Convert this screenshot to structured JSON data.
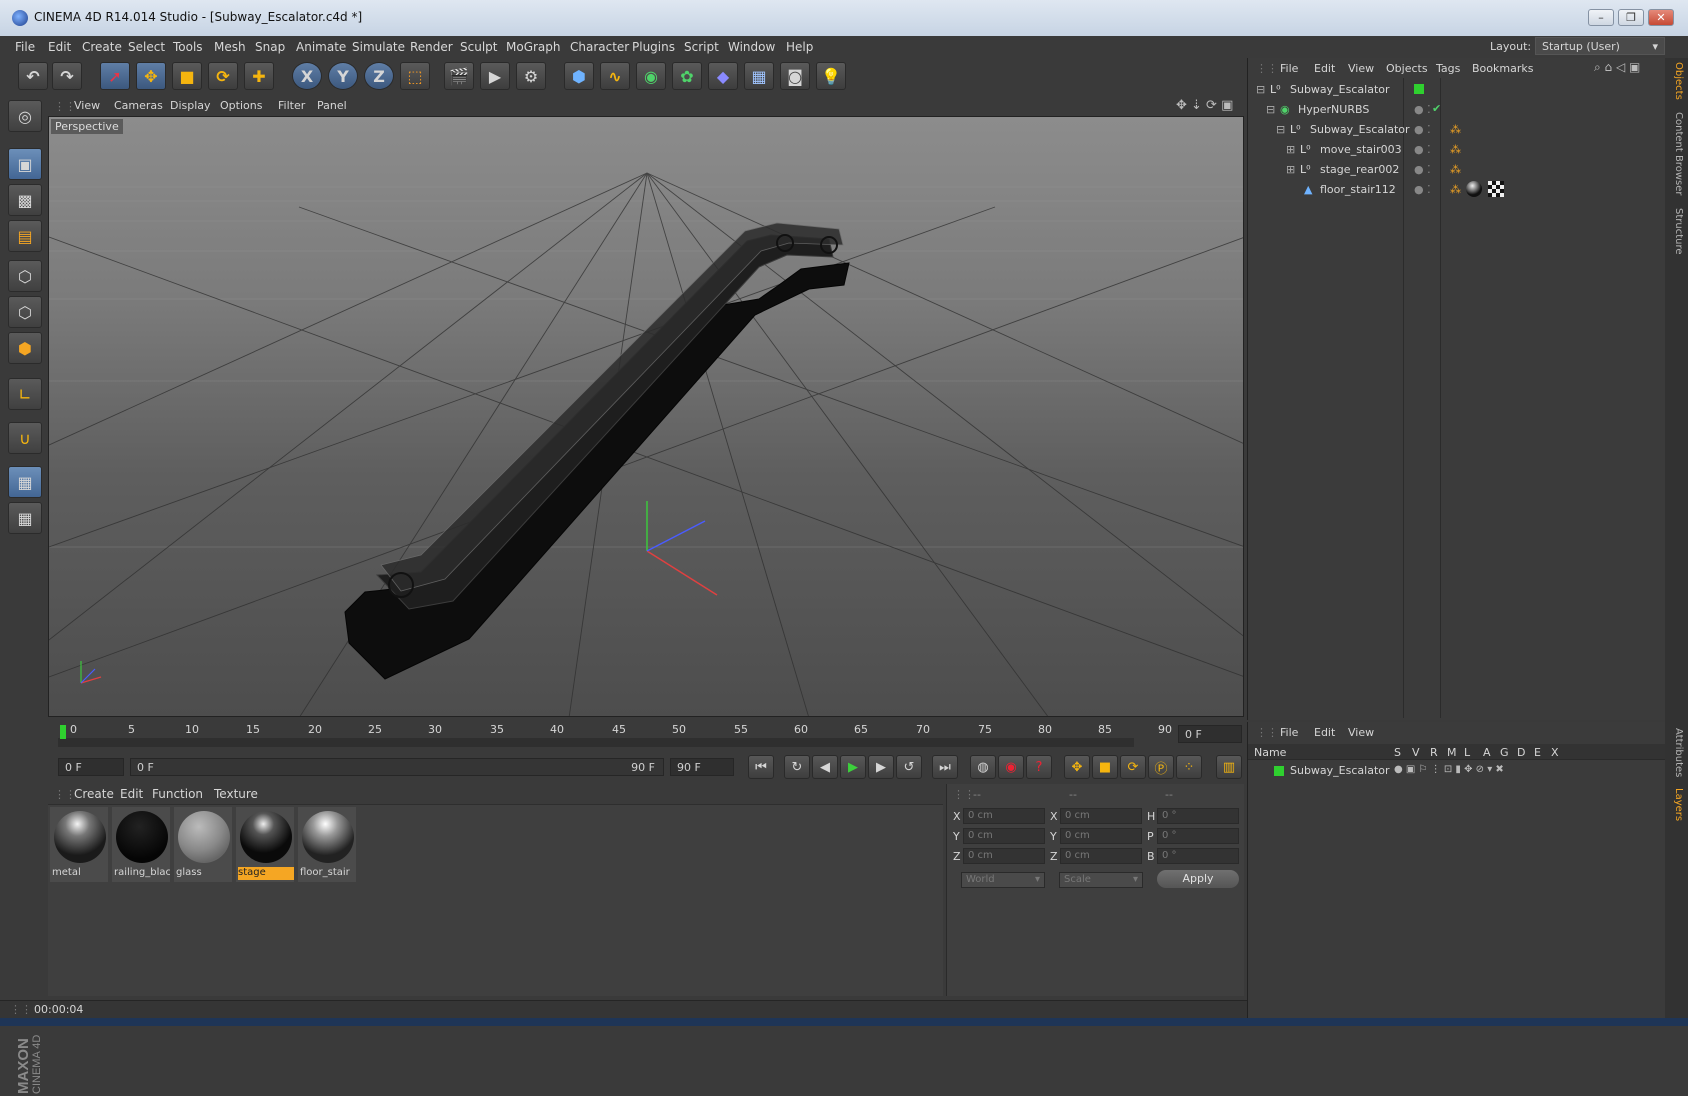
{
  "window": {
    "title": "CINEMA 4D R14.014 Studio - [Subway_Escalator.c4d *]",
    "controls": [
      "–",
      "❐",
      "✕"
    ]
  },
  "menu": {
    "items": [
      "File",
      "Edit",
      "Create",
      "Select",
      "Tools",
      "Mesh",
      "Snap",
      "Animate",
      "Simulate",
      "Render",
      "Sculpt",
      "MoGraph",
      "Character",
      "Plugins",
      "Script",
      "Window",
      "Help"
    ],
    "layout_label": "Layout:",
    "layout_value": "Startup (User)"
  },
  "toolbar": {
    "axis_x": "X",
    "axis_y": "Y",
    "axis_z": "Z"
  },
  "viewport": {
    "menu": [
      "View",
      "Cameras",
      "Display",
      "Options",
      "Filter",
      "Panel"
    ],
    "label": "Perspective"
  },
  "timeline": {
    "ticks": [
      "0",
      "5",
      "10",
      "15",
      "20",
      "25",
      "30",
      "35",
      "40",
      "45",
      "50",
      "55",
      "60",
      "65",
      "70",
      "75",
      "80",
      "85",
      "90"
    ],
    "current_frame": "0 F",
    "start_field": "0 F",
    "slider_start": "0 F",
    "slider_end": "90 F",
    "end_field": "90 F"
  },
  "materials": {
    "menu": [
      "Create",
      "Edit",
      "Function",
      "Texture"
    ],
    "items": [
      {
        "name": "metal",
        "selected": false
      },
      {
        "name": "railing_blac",
        "selected": false
      },
      {
        "name": "glass",
        "selected": false
      },
      {
        "name": "stage",
        "selected": true
      },
      {
        "name": "floor_stair",
        "selected": false
      }
    ]
  },
  "coords": {
    "headers": [
      "--",
      "--",
      "--"
    ],
    "rows": [
      {
        "a": "X",
        "av": "0 cm",
        "b": "X",
        "bv": "0 cm",
        "c": "H",
        "cv": "0 °"
      },
      {
        "a": "Y",
        "av": "0 cm",
        "b": "Y",
        "bv": "0 cm",
        "c": "P",
        "cv": "0 °"
      },
      {
        "a": "Z",
        "av": "0 cm",
        "b": "Z",
        "bv": "0 cm",
        "c": "B",
        "cv": "0 °"
      }
    ],
    "world": "World",
    "scale": "Scale",
    "apply": "Apply"
  },
  "objects": {
    "menu": [
      "File",
      "Edit",
      "View",
      "Objects",
      "Tags",
      "Bookmarks"
    ],
    "tree": [
      {
        "name": "Subway_Escalator",
        "level": 0
      },
      {
        "name": "HyperNURBS",
        "level": 1
      },
      {
        "name": "Subway_Escalator",
        "level": 2
      },
      {
        "name": "move_stair003",
        "level": 3
      },
      {
        "name": "stage_rear002",
        "level": 3
      },
      {
        "name": "floor_stair112",
        "level": 3
      }
    ]
  },
  "layers": {
    "menu": [
      "File",
      "Edit",
      "View"
    ],
    "columns": [
      "Name",
      "S",
      "V",
      "R",
      "M",
      "L",
      "A",
      "G",
      "D",
      "E",
      "X"
    ],
    "items": [
      {
        "name": "Subway_Escalator"
      }
    ]
  },
  "sidetabs": [
    "Objects",
    "Content Browser",
    "Structure",
    "Attributes",
    "Layers"
  ],
  "status": {
    "time": "00:00:04"
  },
  "brand": {
    "maxon": "MAXON",
    "cinema": "CINEMA 4D"
  },
  "colors": {
    "accent": "#f5a623",
    "selected_tool": "#4f6f99",
    "layer_green": "#2fd02f"
  }
}
